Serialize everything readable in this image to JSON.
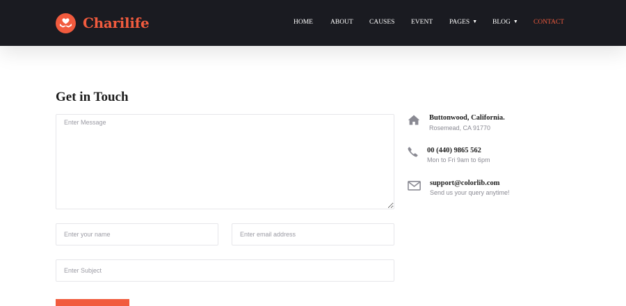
{
  "brand": {
    "name": "Charilife"
  },
  "nav": {
    "home": "Home",
    "about": "About",
    "causes": "Causes",
    "event": "Event",
    "pages": "Pages",
    "blog": "Blog",
    "contact": "Contact"
  },
  "contact_form": {
    "title": "Get in Touch",
    "message_placeholder": "Enter Message",
    "name_placeholder": "Enter your name",
    "email_placeholder": "Enter email address",
    "subject_placeholder": "Enter Subject"
  },
  "contact_info": {
    "address": {
      "icon": "home-icon",
      "title": "Buttonwood, California.",
      "sub": "Rosemead, CA 91770"
    },
    "phone": {
      "icon": "phone-icon",
      "title": "00 (440) 9865 562",
      "sub": "Mon to Fri 9am to 6pm"
    },
    "email": {
      "icon": "envelope-icon",
      "title": "support@colorlib.com",
      "sub": "Send us your query anytime!"
    }
  },
  "colors": {
    "accent": "#f15b3e",
    "header_bg": "#1a1b21",
    "icon_gray": "#8a8a93"
  }
}
